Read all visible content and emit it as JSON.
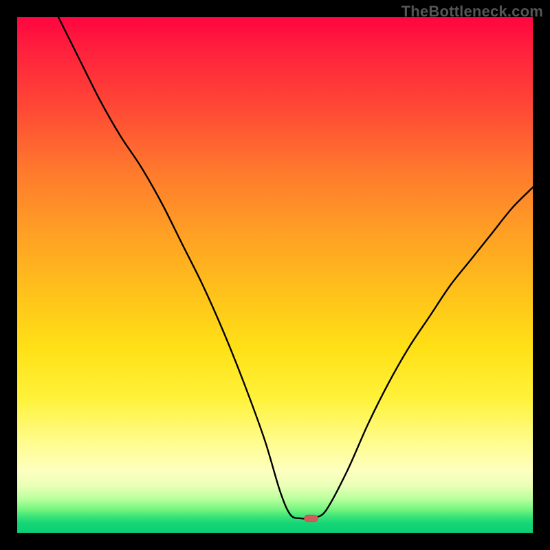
{
  "watermark": "TheBottleneck.com",
  "chart_data": {
    "type": "line",
    "title": "",
    "xlabel": "",
    "ylabel": "",
    "xlim": [
      0,
      100
    ],
    "ylim": [
      0,
      100
    ],
    "legend": false,
    "grid": false,
    "background": "red-yellow-green vertical gradient",
    "curve": {
      "note": "Approximate (x, y) points read from the plot; y=0 is bottom, y=100 is top. Shows a V-shaped bottleneck curve with minimum around x≈56–58.",
      "points": [
        [
          8,
          100
        ],
        [
          12,
          92
        ],
        [
          16,
          84
        ],
        [
          20,
          77
        ],
        [
          24,
          71
        ],
        [
          28,
          64
        ],
        [
          32,
          56
        ],
        [
          36,
          48
        ],
        [
          40,
          39
        ],
        [
          44,
          29
        ],
        [
          48,
          18
        ],
        [
          51,
          8
        ],
        [
          53,
          3.5
        ],
        [
          55,
          2.8
        ],
        [
          57,
          2.8
        ],
        [
          58,
          3
        ],
        [
          60,
          4.5
        ],
        [
          64,
          12
        ],
        [
          68,
          21
        ],
        [
          72,
          29
        ],
        [
          76,
          36
        ],
        [
          80,
          42
        ],
        [
          84,
          48
        ],
        [
          88,
          53
        ],
        [
          92,
          58
        ],
        [
          96,
          63
        ],
        [
          100,
          67
        ]
      ]
    },
    "marker": {
      "shape": "rounded-pill",
      "x": 57,
      "y": 2.8,
      "color": "#d15a5a"
    }
  }
}
